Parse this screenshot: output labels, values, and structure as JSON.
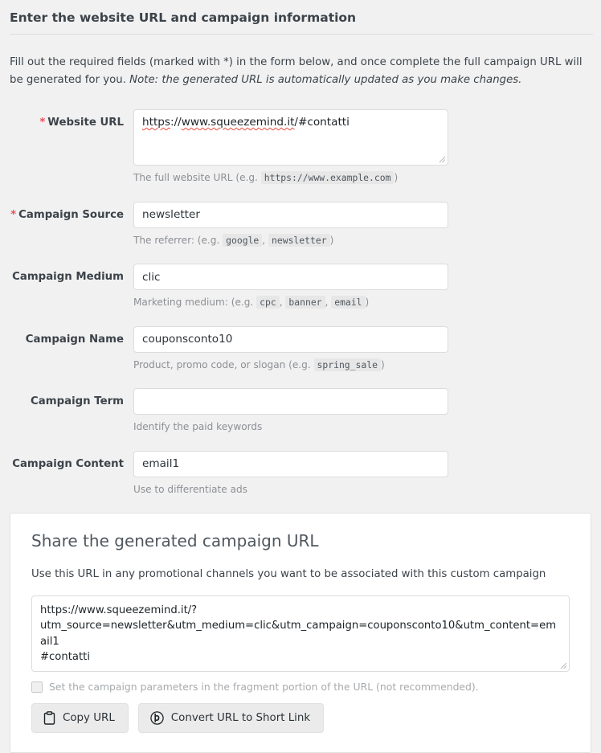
{
  "header": {
    "title": "Enter the website URL and campaign information"
  },
  "intro": {
    "text_before": "Fill out the required fields (marked with *) in the form below, and once complete the full campaign URL will be generated for you. ",
    "note": "Note: the generated URL is automatically updated as you make changes."
  },
  "colors": {
    "required_asterisk": "#e8505b",
    "page_background": "#f1f1f1",
    "panel_background": "#ffffff",
    "border": "#dcdcde",
    "help_text": "#8c8f94",
    "button_background": "#ebebeb",
    "spellcheck_underline": "#e64b3b"
  },
  "form": {
    "fields": [
      {
        "id": "website-url",
        "label": "Website URL",
        "required": true,
        "required_marker": "*",
        "type": "textarea",
        "value": "https://www.squeezemind.it/#contatti",
        "value_parts": [
          {
            "text": "https",
            "spellcheck_error": true
          },
          {
            "text": "://",
            "spellcheck_error": false
          },
          {
            "text": "www.squeezemind.it",
            "spellcheck_error": true
          },
          {
            "text": "/#contatti",
            "spellcheck_error": false
          }
        ],
        "placeholder": "",
        "help_prefix": "The full website URL (e.g. ",
        "help_codes": [
          "https://www.example.com"
        ],
        "help_suffix": ")"
      },
      {
        "id": "campaign-source",
        "label": "Campaign Source",
        "required": true,
        "required_marker": "*",
        "type": "text",
        "value": "newsletter",
        "placeholder": "",
        "help_prefix": "The referrer: (e.g. ",
        "help_codes": [
          "google",
          "newsletter"
        ],
        "help_suffix": ")"
      },
      {
        "id": "campaign-medium",
        "label": "Campaign Medium",
        "required": false,
        "required_marker": "",
        "type": "text",
        "value": "clic",
        "placeholder": "",
        "help_prefix": "Marketing medium: (e.g. ",
        "help_codes": [
          "cpc",
          "banner",
          "email"
        ],
        "help_suffix": ")"
      },
      {
        "id": "campaign-name",
        "label": "Campaign Name",
        "required": false,
        "required_marker": "",
        "type": "text",
        "value": "couponsconto10",
        "placeholder": "",
        "help_prefix": "Product, promo code, or slogan (e.g. ",
        "help_codes": [
          "spring_sale"
        ],
        "help_suffix": ")"
      },
      {
        "id": "campaign-term",
        "label": "Campaign Term",
        "required": false,
        "required_marker": "",
        "type": "text",
        "value": "",
        "placeholder": "",
        "help_prefix": "Identify the paid keywords",
        "help_codes": [],
        "help_suffix": ""
      },
      {
        "id": "campaign-content",
        "label": "Campaign Content",
        "required": false,
        "required_marker": "",
        "type": "text",
        "value": "email1",
        "placeholder": "",
        "help_prefix": "Use to differentiate ads",
        "help_codes": [],
        "help_suffix": ""
      }
    ]
  },
  "share": {
    "title": "Share the generated campaign URL",
    "subtitle": "Use this URL in any promotional channels you want to be associated with this custom campaign",
    "generated_url": "https://www.squeezemind.it/?utm_source=newsletter&utm_medium=clic&utm_campaign=couponsconto10&utm_content=email1#contatti",
    "generated_url_lines": [
      "https://www.squeezemind.it/?",
      "utm_source=newsletter&utm_medium=clic&utm_campaign=couponsconto10&utm_content=email1",
      "#contatti"
    ],
    "fragment_checkbox": {
      "label": "Set the campaign parameters in the fragment portion of the URL (not recommended).",
      "checked": false,
      "disabled": true
    },
    "buttons": [
      {
        "id": "copy-url",
        "label": "Copy URL",
        "icon": "clipboard-icon"
      },
      {
        "id": "convert-short-link",
        "label": "Convert URL to Short Link",
        "icon": "bitly-icon"
      }
    ]
  }
}
